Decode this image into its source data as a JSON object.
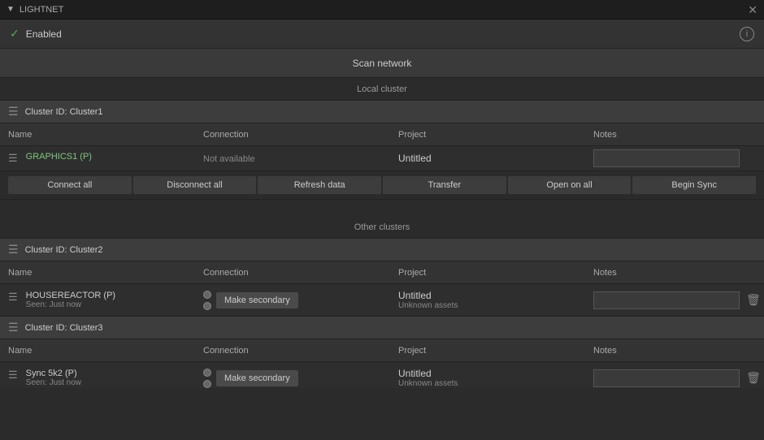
{
  "titleBar": {
    "title": "LIGHTNET",
    "close": "✕"
  },
  "enabled": {
    "checkmark": "✓",
    "label": "Enabled",
    "info": "i"
  },
  "scanNetwork": {
    "label": "Scan network"
  },
  "localCluster": {
    "sectionLabel": "Local cluster",
    "clusterId": "Cluster ID: Cluster1",
    "tableHeaders": {
      "name": "Name",
      "connection": "Connection",
      "project": "Project",
      "notes": "Notes"
    },
    "row": {
      "name": "GRAPHICS1 (P)",
      "connection": "Not available",
      "project": "Untitled",
      "notes": ""
    },
    "actions": {
      "connectAll": "Connect all",
      "disconnectAll": "Disconnect all",
      "refreshData": "Refresh data",
      "transfer": "Transfer",
      "openOnAll": "Open on all",
      "beginSync": "Begin Sync"
    }
  },
  "otherClusters": {
    "sectionLabel": "Other clusters",
    "clusters": [
      {
        "clusterId": "Cluster ID: Cluster2",
        "tableHeaders": {
          "name": "Name",
          "connection": "Connection",
          "project": "Project",
          "notes": "Notes"
        },
        "rows": [
          {
            "name": "HOUSEREACTOR (P)",
            "seen": "Seen: Just now",
            "makeSecondary": "Make secondary",
            "project": "Untitled",
            "projectSub": "Unknown assets",
            "notes": ""
          }
        ]
      },
      {
        "clusterId": "Cluster ID: Cluster3",
        "tableHeaders": {
          "name": "Name",
          "connection": "Connection",
          "project": "Project",
          "notes": "Notes"
        },
        "rows": [
          {
            "name": "Sync 5k2 (P)",
            "seen": "Seen: Just now",
            "makeSecondary": "Make secondary",
            "project": "Untitled",
            "projectSub": "Unknown assets",
            "notes": ""
          }
        ]
      }
    ]
  }
}
